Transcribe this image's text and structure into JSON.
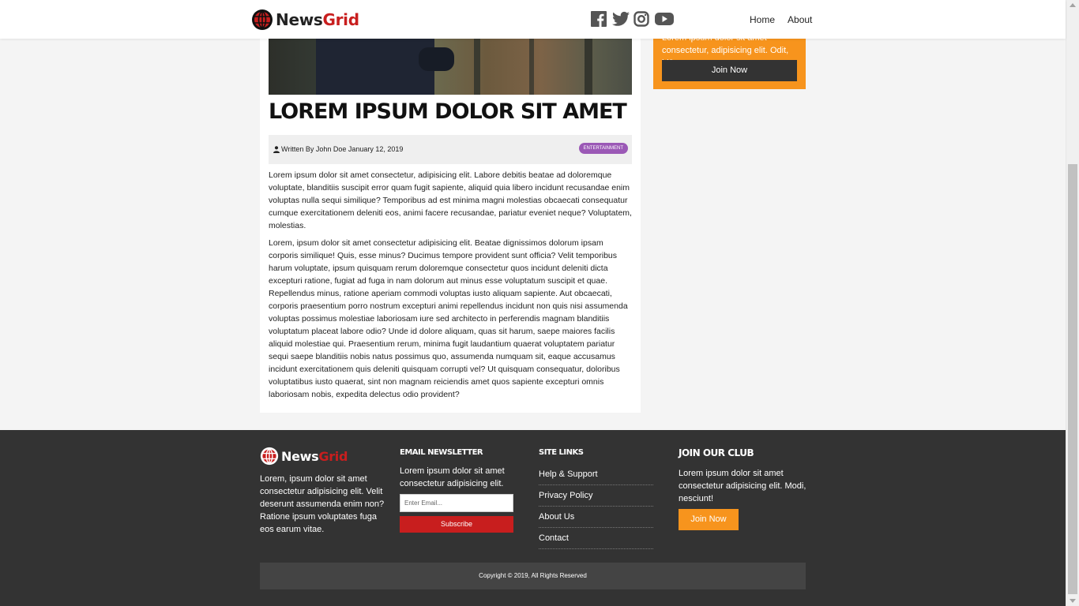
{
  "brand": {
    "name_part1": "News",
    "name_part2": "Grid",
    "accent": "#c81e1e",
    "orange": "#f7941d",
    "purple": "#9b59b6"
  },
  "nav": {
    "social": [
      "facebook-icon",
      "twitter-icon",
      "instagram-icon",
      "youtube-icon"
    ],
    "links": [
      "Home",
      "About"
    ]
  },
  "article": {
    "title": "LOREM IPSUM DOLOR SIT AMET",
    "author": "Written By John Doe January 12, 2019",
    "category": "ENTERTAINMENT",
    "paragraphs": [
      "Lorem ipsum dolor sit amet consectetur, adipisicing elit. Labore debitis beatae ad doloremque voluptate, blanditiis suscipit error quam fugit sapiente, aliquid quia libero incidunt recusandae enim voluptas nulla sequi similique? Temporibus ad est minima magni molestias obcaecati consequatur cumque exercitationem deleniti eos, animi facere recusandae, pariatur eveniet neque? Voluptatem, molestias.",
      "Lorem, ipsum dolor sit amet consectetur adipisicing elit. Beatae dignissimos dolorum ipsam corporis similique! Quis, esse minus? Ducimus tempore provident sunt officia? Velit temporibus harum voluptate, ipsum quisquam rerum doloremque consectetur quos incidunt deleniti dicta excepturi ratione, fugiat ad fuga in nam dolorum aut minus esse voluptatum suscipit et quae. Repellendus minus, ratione aperiam commodi voluptas iusto aliquam sapiente. Aut obcaecati, corporis praesentium porro nostrum excepturi animi repellendus incidunt non quis nisi assumenda voluptas possimus molestiae laboriosam iure sed architecto in perferendis magnam blanditiis voluptatum placeat labore odio? Unde id dolore aliquam, quas sit harum, saepe maiores facilis aliquid molestiae qui. Praesentium rerum, minima fugit laudantium quaerat voluptatem pariatur sequi saepe blanditiis nobis natus possimus quo, assumenda numquam sit, eaque accusamus incidunt exercitationem quis deleniti quisquam corrupti vel? Ut quisquam consequatur, doloribus voluptatibus iusto quaerat, sint non magnam reiciendis amet quos sapiente excepturi omnis laboriosam nobis, expedita delectus odio provident?"
    ]
  },
  "sidebar": {
    "text": "Lorem ipsum dolor sit amet consectetur, adipisicing elit. Odit, id?",
    "button": "Join Now"
  },
  "footer": {
    "about": "Lorem, ipsum dolor sit amet consectetur adipisicing elit. Velit deserunt assumenda enim non? Ratione ipsum voluptates fuga eos earum vitae.",
    "newsletter_heading": "EMAIL NEWSLETTER",
    "newsletter_text": "Lorem ipsum dolor sit amet consectetur adipisicing elit.",
    "email_placeholder": "Enter Email...",
    "subscribe": "Subscribe",
    "links_heading": "SITE LINKS",
    "links": [
      "Help & Support",
      "Privacy Policy",
      "About Us",
      "Contact"
    ],
    "club_heading": "JOIN OUR CLUB",
    "club_text": "Lorem ipsum dolor sit amet consectetur adipisicing elit. Modi, nesciunt!",
    "club_button": "Join Now",
    "copyright": "Copyright © 2019, All Rights Reserved"
  }
}
